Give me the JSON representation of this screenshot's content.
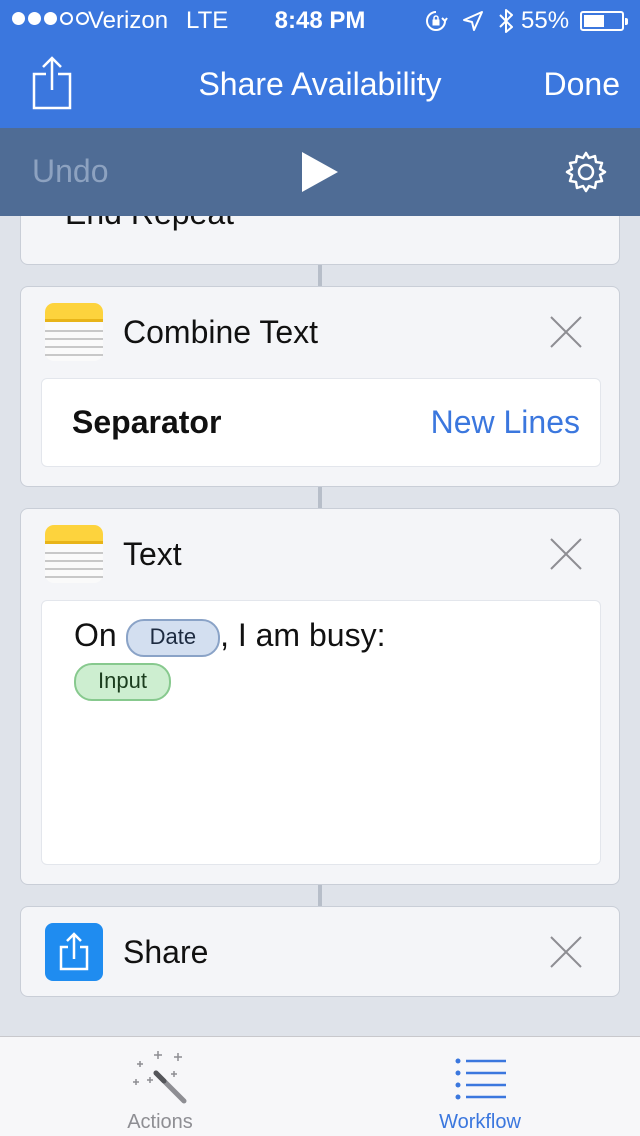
{
  "status_bar": {
    "carrier": "Verizon",
    "network": "LTE",
    "time": "8:48 PM",
    "battery_percent": "55%",
    "signal_bars_filled": 3,
    "signal_bars_total": 5,
    "battery_level": 0.55
  },
  "nav": {
    "title": "Share Availability",
    "done_label": "Done",
    "share_icon": "share-icon"
  },
  "toolbar": {
    "undo_label": "Undo",
    "play_icon": "play-icon",
    "settings_icon": "gear-icon"
  },
  "workflow": {
    "end_repeat": {
      "label": "End Repeat"
    },
    "combine_text": {
      "title": "Combine Text",
      "icon": "notes-icon",
      "separator_label": "Separator",
      "separator_value": "New Lines"
    },
    "text_action": {
      "title": "Text",
      "icon": "notes-icon",
      "prefix": "On",
      "date_token": "Date",
      "suffix": ", I am busy:",
      "input_token": "Input"
    },
    "share_action": {
      "title": "Share",
      "icon": "share-icon"
    }
  },
  "tabs": [
    {
      "label": "Actions",
      "icon": "magic-wand-icon",
      "selected": false
    },
    {
      "label": "Workflow",
      "icon": "list-icon",
      "selected": true
    }
  ],
  "colors": {
    "accent": "#3b77de",
    "toolbar": "#4f6c95",
    "date_token": "#d3dff0",
    "input_token": "#cdeed0"
  }
}
